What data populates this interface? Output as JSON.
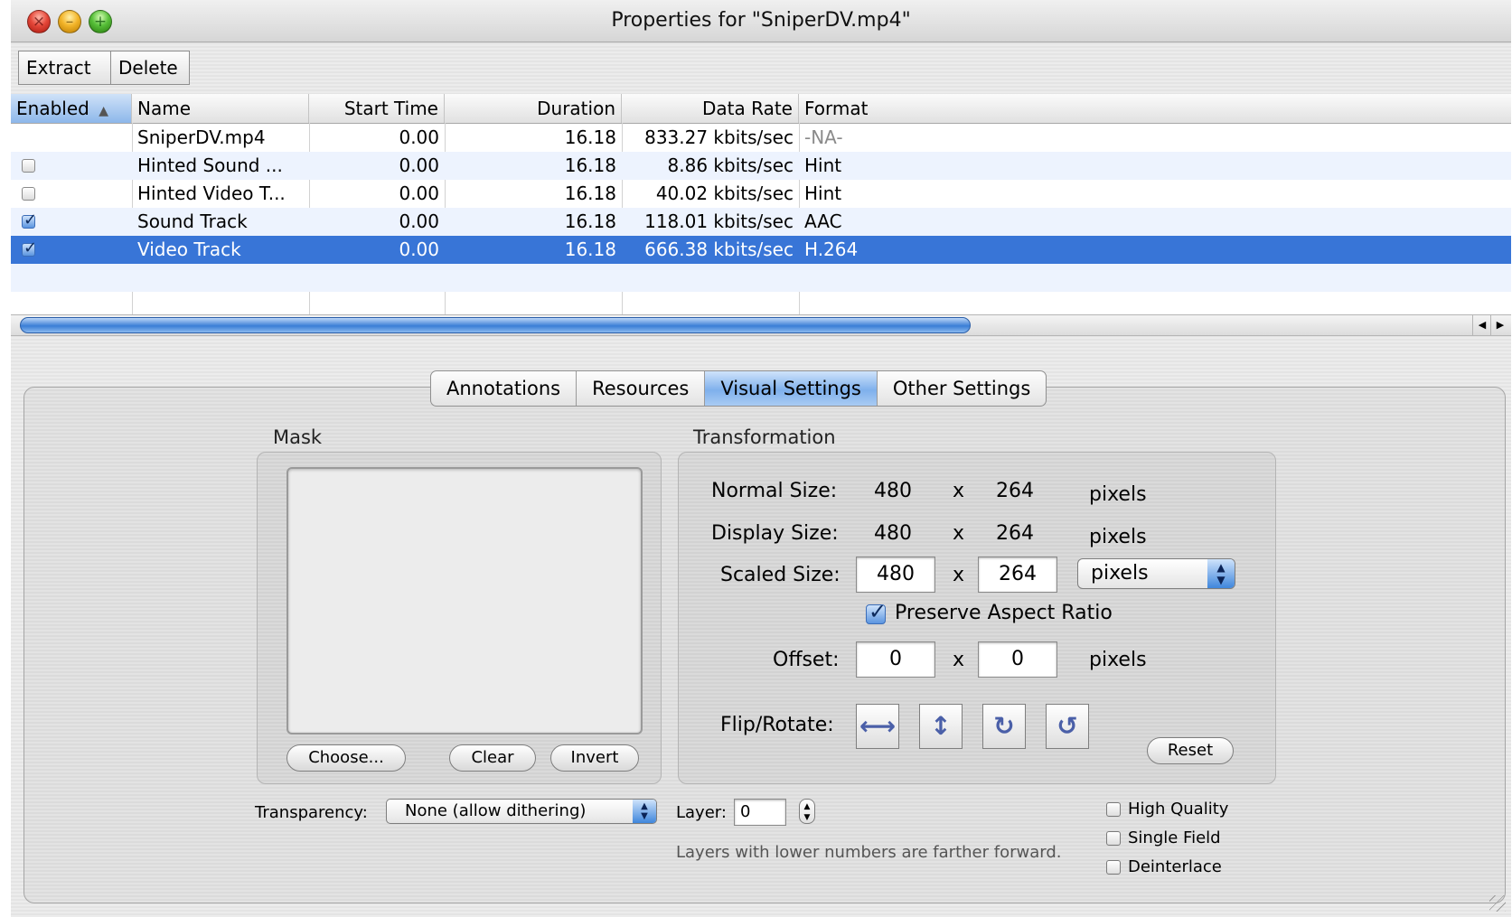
{
  "window": {
    "title": "Properties for \"SniperDV.mp4\""
  },
  "toolbar": {
    "extract_label": "Extract",
    "delete_label": "Delete"
  },
  "table": {
    "columns": {
      "enabled": "Enabled",
      "sort_indicator": "▲",
      "name": "Name",
      "start": "Start Time",
      "duration": "Duration",
      "rate": "Data Rate",
      "format": "Format"
    },
    "rows": [
      {
        "checkbox": "none",
        "name": "SniperDV.mp4",
        "start": "0.00",
        "duration": "16.18",
        "rate": "833.27 kbits/sec",
        "format": "-NA-"
      },
      {
        "checkbox": "unchecked",
        "name": "Hinted Sound ...",
        "start": "0.00",
        "duration": "16.18",
        "rate": "8.86 kbits/sec",
        "format": "Hint"
      },
      {
        "checkbox": "unchecked",
        "name": "Hinted Video T...",
        "start": "0.00",
        "duration": "16.18",
        "rate": "40.02 kbits/sec",
        "format": "Hint"
      },
      {
        "checkbox": "checked",
        "name": "Sound Track",
        "start": "0.00",
        "duration": "16.18",
        "rate": "118.01 kbits/sec",
        "format": "AAC"
      },
      {
        "checkbox": "checked",
        "name": "Video Track",
        "start": "0.00",
        "duration": "16.18",
        "rate": "666.38 kbits/sec",
        "format": "H.264",
        "selected": true
      }
    ]
  },
  "tabs": [
    "Annotations",
    "Resources",
    "Visual Settings",
    "Other Settings"
  ],
  "active_tab": "Visual Settings",
  "mask": {
    "title": "Mask",
    "choose_label": "Choose...",
    "clear_label": "Clear",
    "invert_label": "Invert"
  },
  "transformation": {
    "title": "Transformation",
    "normal_size_label": "Normal Size:",
    "normal_w": "480",
    "normal_h": "264",
    "display_size_label": "Display Size:",
    "display_w": "480",
    "display_h": "264",
    "scaled_size_label": "Scaled Size:",
    "scaled_w": "480",
    "scaled_h": "264",
    "scaled_unit": "pixels",
    "times": "x",
    "unit": "pixels",
    "preserve_label": "Preserve Aspect Ratio",
    "offset_label": "Offset:",
    "offset_x": "0",
    "offset_y": "0",
    "flip_label": "Flip/Rotate:",
    "flip_h_glyph": "⟷",
    "flip_v_glyph": "↕",
    "rotate_cw_glyph": "↻",
    "rotate_ccw_glyph": "↺",
    "reset_label": "Reset"
  },
  "transparency": {
    "label": "Transparency:",
    "value": "None (allow dithering)"
  },
  "layer": {
    "label": "Layer:",
    "value": "0",
    "hint": "Layers with lower numbers are farther forward."
  },
  "options": {
    "high_quality": "High Quality",
    "single_field": "Single Field",
    "deinterlace": "Deinterlace"
  },
  "colors": {
    "selection": "#3875d7",
    "accent": "#7fb0ec"
  }
}
